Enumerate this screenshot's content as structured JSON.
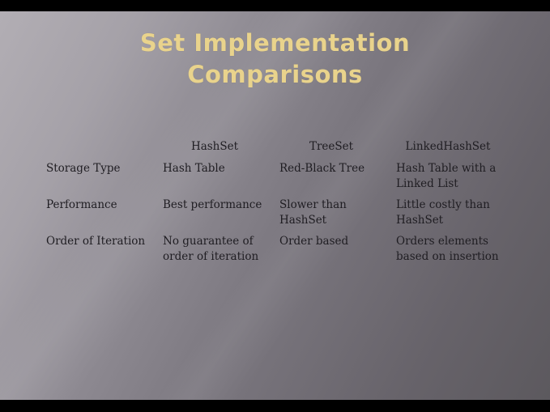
{
  "slide": {
    "title_line1": "Set Implementation",
    "title_line2": "Comparisons",
    "colors": {
      "title": "#e9d38c",
      "text": "#1f1d22",
      "letterbox": "#000000"
    }
  },
  "table": {
    "headers": [
      "",
      "HashSet",
      "TreeSet",
      "LinkedHashSet"
    ],
    "rows": [
      {
        "label": "Storage Type",
        "cells": [
          "Hash Table",
          "Red-Black Tree",
          "Hash Table with a Linked List"
        ]
      },
      {
        "label": "Performance",
        "cells": [
          "Best performance",
          "Slower than HashSet",
          "Little costly than HashSet"
        ]
      },
      {
        "label": "Order of Iteration",
        "cells": [
          "No guarantee of order of iteration",
          "Order based",
          "Orders elements based on insertion"
        ]
      }
    ]
  }
}
